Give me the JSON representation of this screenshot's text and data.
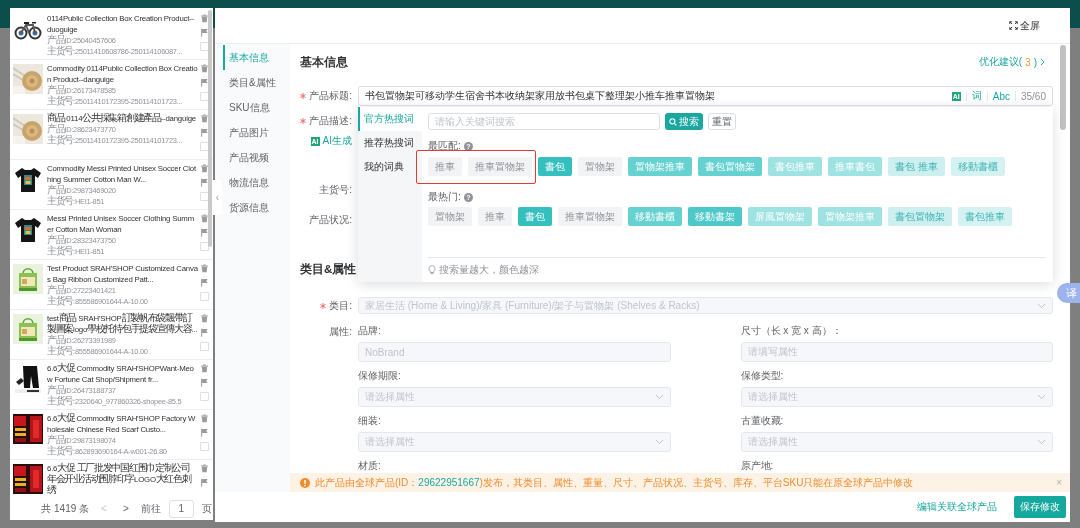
{
  "product_list": {
    "items": [
      {
        "title": "0114Public Collection Box Creation Product--duoguige",
        "product_id": "产品ID:25040457606",
        "sku": "主货号:25011410608786-250114106087...",
        "checked": false
      },
      {
        "title": "Commodity 0114Public Collection Box Creation Product--danguige",
        "product_id": "产品ID:26173478585",
        "sku": "主货号:25011410172395-250114101723...",
        "checked": false
      },
      {
        "title": "商品 0114公共採集箱創建產品--danguige",
        "product_id": "产品ID:28623473770",
        "sku": "主货号:25011410172395-250114101723...",
        "checked": false
      },
      {
        "title": "Commodity Messi Printed Unisex Soccer Clothing Summer Cotton Man W...",
        "product_id": "产品ID:29873469020",
        "sku": "主货号:HEI1-851",
        "checked": false
      },
      {
        "title": "Messi Printed Unisex Soccer Clothing Summer Cotton Man Woman",
        "product_id": "产品ID:28323473750",
        "sku": "主货号:HEI1-851",
        "checked": false
      },
      {
        "title": "Test Product SRAH'SHOP Customized Canvas Bag Ribbon Customized Patt...",
        "product_id": "产品ID:27223401421",
        "sku": "主货号:855586901644-A-10.00",
        "checked": false
      },
      {
        "title": "test商品 SRAH'SHOP訂製帆布袋飄帶訂製圖案logo學校托特包手提袋宣傳大容...",
        "product_id": "产品ID:26273391989",
        "sku": "主货号:855586901644-A-10.00",
        "checked": false
      },
      {
        "title": "6.6大促 Commodity SRAH'SHOPWant-Meow Fortune Cat Shop/Shipment fr...",
        "product_id": "产品ID:26473188737",
        "sku": "主货号:2320640_977860326-shopee-85.5",
        "checked": false
      },
      {
        "title": "6.6大促 Commodity SRAH'SHOP Factory Wholesale Chinese Red Scarf Custo...",
        "product_id": "产品ID:29873198074",
        "sku": "主货号:862893690164-A-w001-26.80",
        "checked": false
      },
      {
        "title": "6.6大促 工厂批发中国红围巾定制公司年会开业活动围脖印字LOGO大红色刺绣"
      }
    ],
    "pager": {
      "total": "共 1419 条",
      "prev": "<",
      "next": ">",
      "goto_label": "前往",
      "page": "1",
      "page_suffix": "页"
    }
  },
  "collapse_handle": "‹",
  "modal": {
    "fullscreen": "全屏",
    "nav": [
      {
        "label": "基本信息",
        "selected": true
      },
      {
        "label": "类目&属性",
        "selected": false
      },
      {
        "label": "SKU信息",
        "selected": false
      },
      {
        "label": "产品图片",
        "selected": false
      },
      {
        "label": "产品视频",
        "selected": false
      },
      {
        "label": "物流信息",
        "selected": false
      },
      {
        "label": "货源信息",
        "selected": false
      }
    ],
    "basic_info": {
      "title": "基本信息",
      "suggestions": {
        "label": "优化建议(",
        "count": "3",
        "suffix": ")"
      },
      "product_title": {
        "label": "产品标题:",
        "required": true,
        "value": "书包置物架可移动学生宿舍书本收纳架家用放书包桌下整理架小推车推車置物架",
        "ai_badge": "AI",
        "word_tool": "词",
        "case_tool": "Abc",
        "counter": "35/60"
      },
      "description": {
        "label": "产品描述:",
        "required": true,
        "ai_badge": "AI",
        "ai_generate": "AI生成"
      },
      "sku": {
        "label": "主货号:",
        "required": false
      },
      "condition": {
        "label": "产品状况:",
        "required": false
      }
    },
    "keyword_popup": {
      "tabs": [
        {
          "label": "官方热搜词",
          "selected": true
        },
        {
          "label": "推荐热搜词",
          "selected": false
        },
        {
          "label": "我的词典",
          "selected": false
        }
      ],
      "search": {
        "placeholder": "请输入关键词搜索"
      },
      "search_button": "搜索",
      "reset_button": "重置",
      "groups": [
        {
          "label": "最匹配:",
          "help": "?",
          "tags": [
            {
              "text": "推車",
              "kind": "plain",
              "color": "#f2f3f5",
              "highlighted": true
            },
            {
              "text": "推車置物架",
              "kind": "plain",
              "color": "#f2f3f5",
              "highlighted": true
            },
            {
              "text": "書包",
              "kind": "hot",
              "color": "#35bfbf"
            },
            {
              "text": "置物架",
              "kind": "plain",
              "color": "#f2f3f5"
            },
            {
              "text": "置物架推車",
              "kind": "hot",
              "color": "#66d1d1"
            },
            {
              "text": "書包置物架",
              "kind": "hot",
              "color": "#66d1d1"
            },
            {
              "text": "書包推車",
              "kind": "hot",
              "color": "#9fe2e2"
            },
            {
              "text": "推車書包",
              "kind": "hot",
              "color": "#9fe2e2"
            },
            {
              "text": "書包 推車",
              "kind": "pale",
              "color": "#cdeff0"
            },
            {
              "text": "移動書櫃",
              "kind": "pale",
              "color": "#d5f2f2"
            }
          ]
        },
        {
          "label": "最热门:",
          "help": "?",
          "tags": [
            {
              "text": "置物架",
              "kind": "plain",
              "color": "#f2f3f5"
            },
            {
              "text": "推車",
              "kind": "plain",
              "color": "#f2f3f5"
            },
            {
              "text": "書包",
              "kind": "hot",
              "color": "#35bfbf"
            },
            {
              "text": "推車置物架",
              "kind": "plain",
              "color": "#f2f3f5"
            },
            {
              "text": "移動書櫃",
              "kind": "hot",
              "color": "#66d1d1"
            },
            {
              "text": "移動書架",
              "kind": "hot",
              "color": "#4ec8c8"
            },
            {
              "text": "屏風置物架",
              "kind": "hot",
              "color": "#9fe2e2"
            },
            {
              "text": "置物架推車",
              "kind": "hot",
              "color": "#9fe2e2"
            },
            {
              "text": "書包置物架",
              "kind": "pale",
              "color": "#cdeff0"
            },
            {
              "text": "書包推車",
              "kind": "pale",
              "color": "#d5f2f2"
            }
          ]
        }
      ],
      "hint": "搜索量越大，颜色越深"
    },
    "category_attributes": {
      "title": "类目&属性",
      "category": {
        "label": "类目:",
        "required": true,
        "value": "家居生活 (Home & Living)/家具 (Furniture)/架子与置物架 (Shelves & Racks)"
      },
      "attributes_label": "属性:",
      "attributes": [
        {
          "label": "品牌:",
          "kind": "text",
          "value": "NoBrand"
        },
        {
          "label": "尺寸（长 x 宽 x 高）：",
          "kind": "text",
          "placeholder": "请填写属性"
        },
        {
          "label": "保修期限:",
          "kind": "select",
          "placeholder": "请选择属性"
        },
        {
          "label": "保修类型:",
          "kind": "select",
          "placeholder": "请选择属性"
        },
        {
          "label": "细装:",
          "kind": "select",
          "placeholder": "请选择属性"
        },
        {
          "label": "古董收藏:",
          "kind": "select",
          "placeholder": "请选择属性"
        },
        {
          "label": "材质:"
        },
        {
          "label": "原产地:"
        }
      ]
    },
    "warning": {
      "text_before": "此产品由全球产品(ID：",
      "product_id": "29622951667",
      "text_after": ")发布，其类目、属性、重量、尺寸、产品状况、主货号、库存、平台SKU只能在原全球产品中修改",
      "close": "×"
    },
    "footer": {
      "link": "编辑关联全球产品",
      "save_button": "保存修改"
    }
  },
  "translate_button": "译"
}
